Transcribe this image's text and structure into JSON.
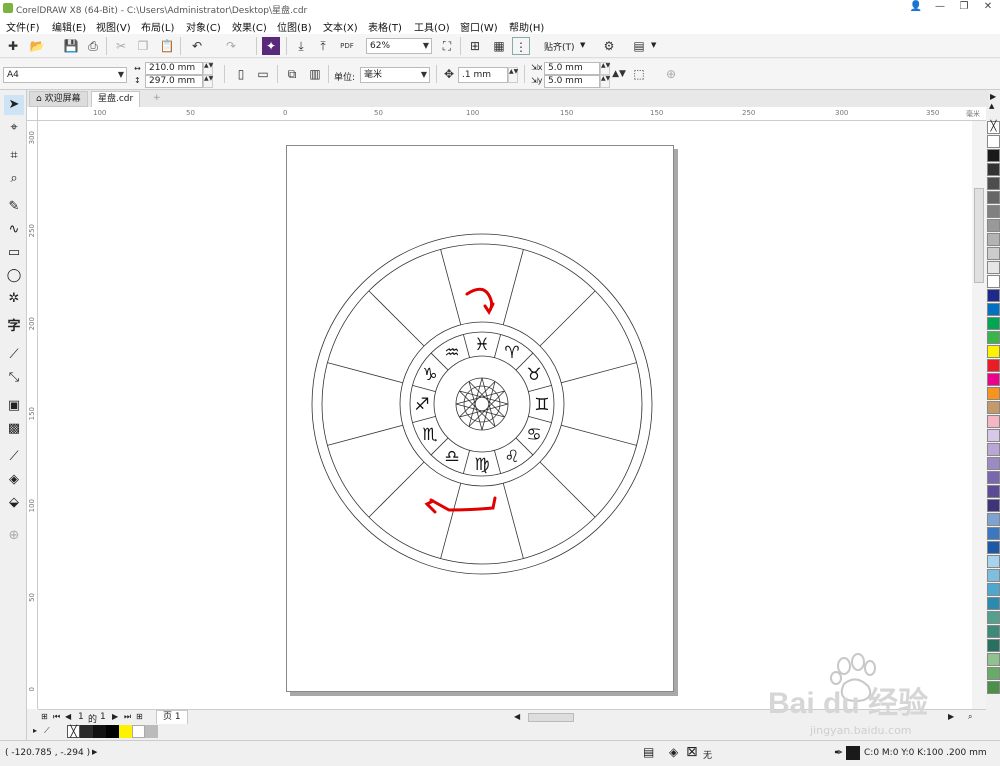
{
  "window": {
    "title": "CorelDRAW X8 (64-Bit) - C:\\Users\\Administrator\\Desktop\\星盘.cdr",
    "minimize": "—",
    "restore": "❐",
    "close": "✕",
    "account": "👤"
  },
  "menu": [
    "文件(F)",
    "编辑(E)",
    "视图(V)",
    "布局(L)",
    "对象(C)",
    "效果(C)",
    "位图(B)",
    "文本(X)",
    "表格(T)",
    "工具(O)",
    "窗口(W)",
    "帮助(H)"
  ],
  "toolbar1": {
    "zoom": "62%",
    "snap": "贴齐(T)",
    "pdf": "PDF"
  },
  "toolbar2": {
    "page_size": "A4",
    "width": "210.0 mm",
    "height": "297.0 mm",
    "units_label": "单位:",
    "units": "毫米",
    "nudge": ".1 mm",
    "dup_x": "5.0 mm",
    "dup_y": "5.0 mm"
  },
  "tabs": {
    "welcome": "欢迎屏幕",
    "doc": "星盘.cdr",
    "add": "+"
  },
  "ruler": {
    "h": [
      "100",
      "50",
      "0",
      "50",
      "100",
      "150",
      "200",
      "250",
      "300",
      "350"
    ],
    "h_unit": "毫米",
    "v": [
      "300",
      "250",
      "200",
      "150",
      "100",
      "50",
      "0"
    ]
  },
  "pagenav": {
    "current": "1",
    "of": "的",
    "total": "1",
    "page_tab": "页 1"
  },
  "status": {
    "coords": "( -120.785 , -.294 )",
    "fill": "无",
    "color_info": "C:0 M:0 Y:0 K:100 .200 mm"
  },
  "watermark": {
    "logo": "Bai du 经验",
    "url": "jingyan.baidu.com"
  },
  "drawing": {
    "zodiac_glyphs": [
      "♈",
      "♉",
      "♊",
      "♋",
      "♌",
      "♍",
      "♎",
      "♏",
      "♐",
      "♑",
      "♒",
      "♓"
    ],
    "annotation_color": "#e00000"
  },
  "palette": [
    "#ffffff",
    "#1a1a1a",
    "#333333",
    "#4d4d4d",
    "#666666",
    "#808080",
    "#999999",
    "#b3b3b3",
    "#cccccc",
    "#e6e6e6",
    "#ffffff",
    "#1d2a8c",
    "#0070c0",
    "#00a651",
    "#39b54a",
    "#fff200",
    "#ed1c24",
    "#ec008c",
    "#f7941d",
    "#c49a6c",
    "#f4b6c2",
    "#d8c8e8",
    "#b9a6d6",
    "#9b8ac4",
    "#7a67b0",
    "#5d4a96",
    "#3f347a",
    "#7fa3d1",
    "#3b78c2",
    "#1d5aa6",
    "#a7d3ef",
    "#7fbedf",
    "#4ea7cf",
    "#2b8aaf",
    "#55a08c",
    "#3c8a78",
    "#2a7060",
    "#8fc28e",
    "#6aaa68",
    "#4a9048"
  ]
}
